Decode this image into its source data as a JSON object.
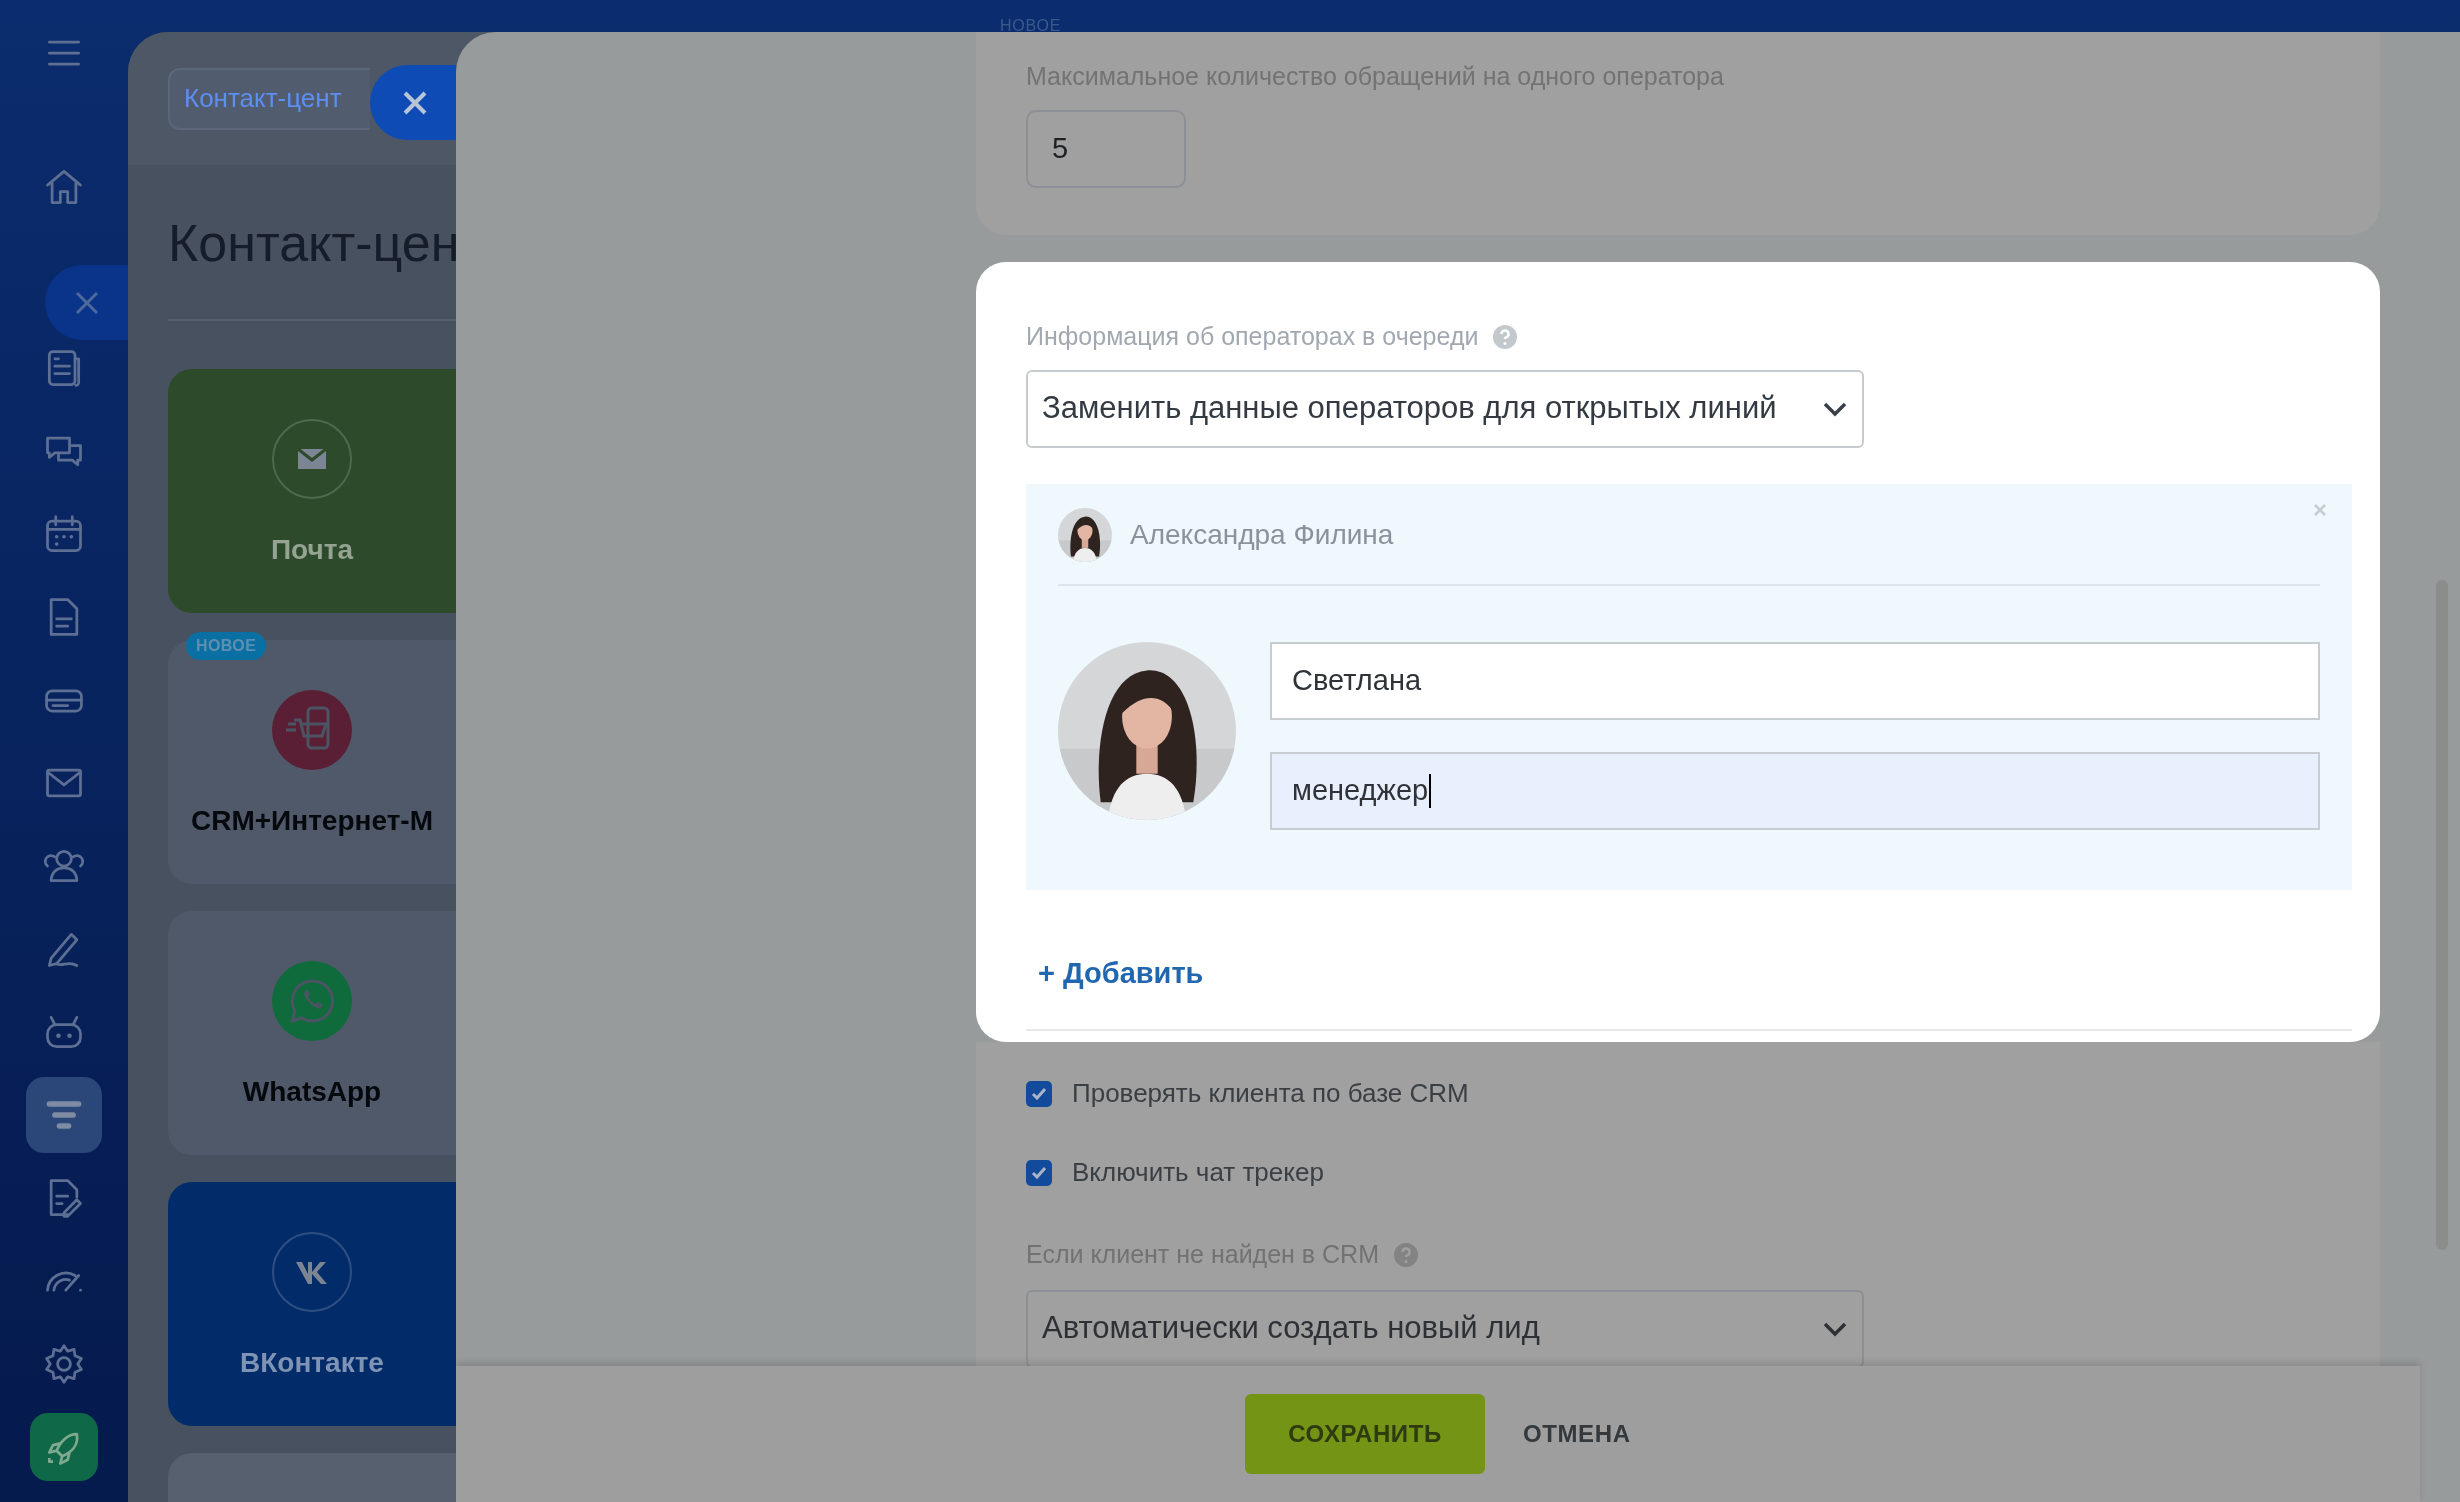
{
  "sidebar": {
    "items": [
      {
        "kind": "menu",
        "selected": false
      },
      {
        "kind": "home",
        "selected": false
      },
      {
        "kind": "news",
        "selected": false
      },
      {
        "kind": "chat",
        "selected": false
      },
      {
        "kind": "calendar",
        "selected": false
      },
      {
        "kind": "document",
        "selected": false
      },
      {
        "kind": "drive",
        "selected": false
      },
      {
        "kind": "mail",
        "selected": false
      },
      {
        "kind": "contacts",
        "selected": false
      },
      {
        "kind": "pen",
        "selected": false
      },
      {
        "kind": "robot",
        "selected": false
      },
      {
        "kind": "filter",
        "selected": true
      },
      {
        "kind": "edit",
        "selected": false
      },
      {
        "kind": "gauge",
        "selected": false
      },
      {
        "kind": "settings",
        "selected": false
      },
      {
        "kind": "rocket",
        "selected": false
      }
    ]
  },
  "background_page": {
    "breadcrumb": "Контакт-цент",
    "title": "Контакт-цен",
    "cards": [
      {
        "label": "Почта",
        "kind": "mail",
        "color": "#2d4a2b"
      },
      {
        "label": "CRM+Интернет-М",
        "kind": "shop",
        "color": "#505969",
        "badge": "НОВОЕ"
      },
      {
        "label": "WhatsApp",
        "kind": "whatsapp",
        "color": "#505969"
      },
      {
        "label": "ВКонтакте",
        "kind": "vk",
        "color": "#022b69"
      },
      {
        "kind": "blank",
        "color": "#56606f"
      }
    ]
  },
  "top_badge": "НОВОЕ",
  "max_requests": {
    "label": "Максимальное количество обращений на одного оператора",
    "value": "5"
  },
  "queue_info": {
    "label": "Информация об операторах в очереди",
    "value": "Заменить данные операторов для открытых линий",
    "operators": [
      {
        "name": "Александра Филина",
        "fields": [
          {
            "value": "Светлана",
            "focused": false
          },
          {
            "value": "менеджер",
            "focused": true
          }
        ]
      }
    ],
    "add_button": "+ Добавить"
  },
  "checkboxes": [
    {
      "label": "Проверять клиента по базе CRM",
      "checked": true
    },
    {
      "label": "Включить чат трекер",
      "checked": true
    }
  ],
  "crm_not_found": {
    "label": "Если клиент не найден в CRM",
    "value": "Автоматически создать новый лид"
  },
  "footer": {
    "save": "СОХРАНИТЬ",
    "cancel": "ОТМЕНА"
  }
}
